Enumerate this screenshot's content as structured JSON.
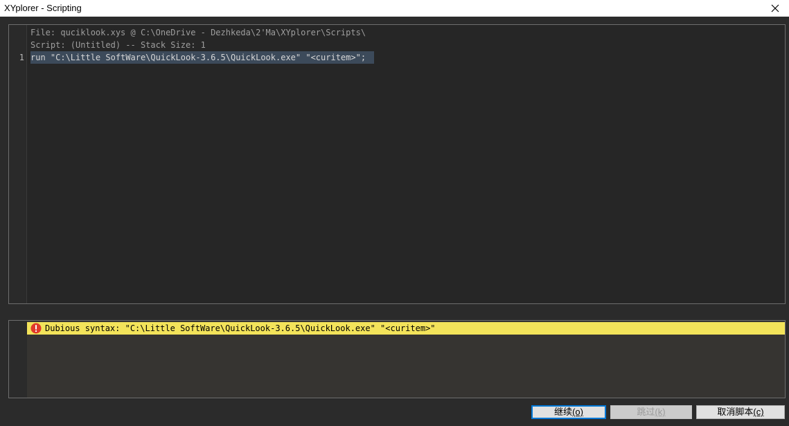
{
  "window": {
    "title": "XYplorer - Scripting"
  },
  "editor": {
    "header_lines": [
      "File: quciklook.xys @ C:\\OneDrive - Dezhkeda\\2'Ma\\XYplorer\\Scripts\\",
      "Script: (Untitled) -- Stack Size: 1"
    ],
    "lines": [
      {
        "number": "1",
        "text": "run \"C:\\Little SoftWare\\QuickLook-3.6.5\\QuickLook.exe\" \"<curitem>\";"
      }
    ]
  },
  "messages": {
    "error_text": "Dubious syntax: \"C:\\Little SoftWare\\QuickLook-3.6.5\\QuickLook.exe\" \"<curitem>\"",
    "error_color": "#f3e35a",
    "icon": "error-icon"
  },
  "buttons": {
    "continue": {
      "label": "继续",
      "accel": "(o)"
    },
    "skip": {
      "label": "跳过",
      "accel": "(k)"
    },
    "cancel": {
      "label": "取消脚本",
      "accel": "(c)"
    }
  },
  "colors": {
    "editor_bg": "#262626",
    "selection": "#3c4a5a",
    "accent": "#0078d7"
  }
}
